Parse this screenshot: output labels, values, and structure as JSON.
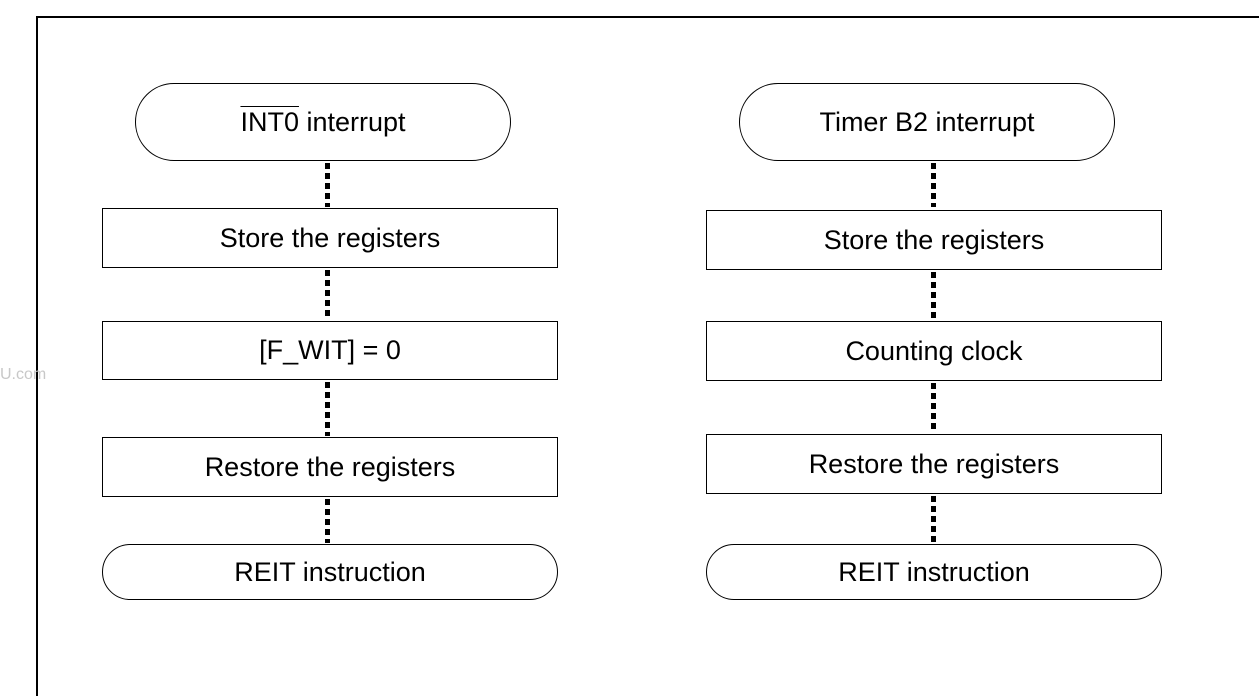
{
  "watermark": "U.com",
  "left_flow": {
    "start_prefix": "INT0",
    "start_prefix_overline": true,
    "start_suffix": " interrupt",
    "step1": "Store the registers",
    "step2": "[F_WIT] = 0",
    "step3": "Restore the registers",
    "end": "REIT instruction"
  },
  "right_flow": {
    "start": "Timer B2 interrupt",
    "step1": "Store the registers",
    "step2": "Counting clock",
    "step3": "Restore the registers",
    "end": "REIT instruction"
  },
  "colors": {
    "line": "#000000",
    "background": "#ffffff",
    "watermark": "#c8c8c8"
  }
}
